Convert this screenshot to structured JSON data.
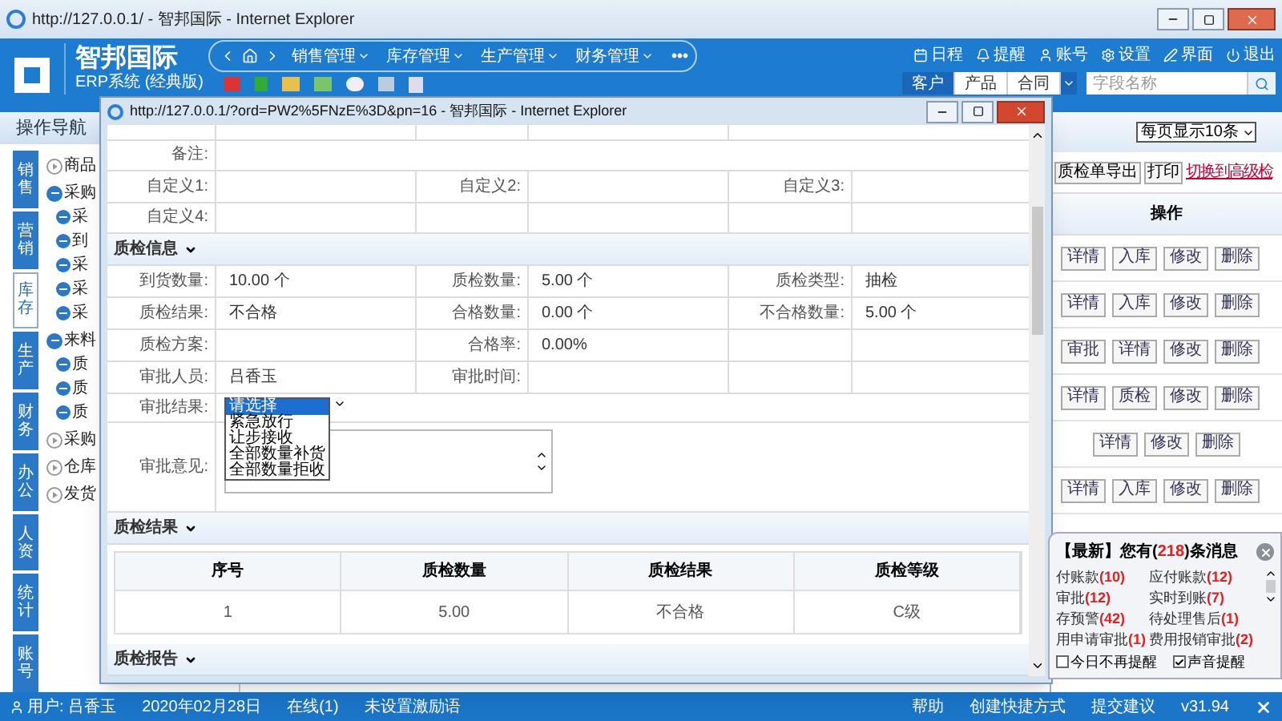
{
  "browser": {
    "title": "http://127.0.0.1/ - 智邦国际 - Internet Explorer"
  },
  "header": {
    "logo_title": "智邦国际",
    "logo_subtitle": "ERP系统 (经典版)",
    "nav_menus": [
      "销售管理",
      "库存管理",
      "生产管理",
      "财务管理"
    ],
    "more": "•••",
    "tools": [
      {
        "kind": "calendar",
        "label": "日程"
      },
      {
        "kind": "bell",
        "label": "提醒"
      },
      {
        "kind": "user",
        "label": "账号"
      },
      {
        "kind": "gear",
        "label": "设置"
      },
      {
        "kind": "brush",
        "label": "界面"
      },
      {
        "kind": "power",
        "label": "退出"
      }
    ],
    "tabs": [
      {
        "label": "客户",
        "selected": true
      },
      {
        "label": "产品",
        "selected": false
      },
      {
        "label": "合同",
        "selected": false
      }
    ],
    "search": {
      "placeholder": "字段名称"
    }
  },
  "sidebar": {
    "title": "操作导航",
    "tabs": [
      {
        "label": "销售",
        "selected": false
      },
      {
        "label": "营销",
        "selected": false
      },
      {
        "label": "库存",
        "selected": true
      },
      {
        "label": "生产",
        "selected": false
      },
      {
        "label": "财务",
        "selected": false
      },
      {
        "label": "办公",
        "selected": false
      },
      {
        "label": "人资",
        "selected": false
      },
      {
        "label": "统计",
        "selected": false
      },
      {
        "label": "账号",
        "selected": false
      }
    ],
    "tree": [
      {
        "label": "商品",
        "expanded": false
      },
      {
        "label": "采购",
        "expanded": true,
        "children": [
          {
            "label": "采",
            "expanded": true
          },
          {
            "label": "到",
            "expanded": true
          },
          {
            "label": "采",
            "expanded": true
          },
          {
            "label": "采",
            "expanded": true
          },
          {
            "label": "采",
            "expanded": true
          }
        ]
      },
      {
        "label": "来料",
        "expanded": true,
        "children": [
          {
            "label": "质",
            "expanded": true
          },
          {
            "label": "质",
            "expanded": true
          },
          {
            "label": "质",
            "expanded": true
          }
        ]
      },
      {
        "label": "采购",
        "expanded": false
      },
      {
        "label": "仓库",
        "expanded": false
      },
      {
        "label": "发货",
        "expanded": false
      }
    ]
  },
  "modal": {
    "title": "http://127.0.0.1/?ord=PW2%5FNzE%3D&pn=16 - 智邦国际 - Internet Explorer",
    "top_rows": [
      {
        "kind": "wide",
        "fields": [
          {
            "label": "备注:"
          }
        ]
      },
      {
        "kind": "fields",
        "fields": [
          {
            "label": "自定义1:"
          },
          {
            "label": "自定义2:"
          },
          {
            "label": "自定义3:"
          }
        ]
      },
      {
        "kind": "fields",
        "fields": [
          {
            "label": "自定义4:"
          }
        ]
      }
    ],
    "sections": [
      {
        "title": "质检信息",
        "rows": [
          {
            "kind": "fields",
            "fields": [
              {
                "label": "到货数量:",
                "value": "10.00 个"
              },
              {
                "label": "质检数量:",
                "value": "5.00 个"
              },
              {
                "label": "质检类型:",
                "value": "抽检"
              }
            ]
          },
          {
            "kind": "fields",
            "fields": [
              {
                "label": "质检结果:",
                "value": "不合格"
              },
              {
                "label": "合格数量:",
                "value": "0.00 个"
              },
              {
                "label": "不合格数量:",
                "value": "5.00 个"
              }
            ]
          },
          {
            "kind": "fields",
            "fields": [
              {
                "label": "质检方案:"
              },
              {
                "label": "合格率:",
                "value": "0.00%"
              }
            ]
          },
          {
            "kind": "fields",
            "fields": [
              {
                "label": "审批人员:",
                "value": "吕香玉"
              },
              {
                "label": "审批时间:"
              }
            ]
          },
          {
            "kind": "select",
            "label": "审批结果:",
            "expanded": true,
            "options": [
              {
                "label": "请选择",
                "selected": true
              },
              {
                "label": "紧急放行",
                "selected": false
              },
              {
                "label": "让步接收",
                "selected": false
              },
              {
                "label": "全部数量补货",
                "selected": false
              },
              {
                "label": "全部数量拒收",
                "selected": false
              }
            ]
          },
          {
            "kind": "textarea",
            "label": "审批意见:"
          }
        ]
      },
      {
        "title": "质检结果",
        "table": {
          "columns": [
            "序号",
            "质检数量",
            "质检结果",
            "质检等级"
          ],
          "rows": [
            [
              "1",
              "5.00",
              "不合格",
              "C级"
            ]
          ]
        }
      },
      {
        "title": "质检报告"
      }
    ]
  },
  "right_panel": {
    "page_size": "每页显示10条",
    "buttons": [
      "质检单导出",
      "打印"
    ],
    "link": "切换到高级检",
    "column": "操作",
    "rows": [
      [
        "详情",
        "入库",
        "修改",
        "删除"
      ],
      [
        "详情",
        "入库",
        "修改",
        "删除"
      ],
      [
        "审批",
        "详情",
        "修改",
        "删除"
      ],
      [
        "详情",
        "质检",
        "修改",
        "删除"
      ],
      [
        "详情",
        "修改",
        "删除"
      ],
      [
        "详情",
        "入库",
        "修改",
        "删除"
      ]
    ]
  },
  "notification": {
    "title_prefix": "【最新】您有(",
    "count": "218",
    "title_suffix": ")条消息",
    "items": [
      {
        "label": "付账款",
        "count": "(10)"
      },
      {
        "label": "应付账款",
        "count": "(12)"
      },
      {
        "label": "审批",
        "count": "(12)"
      },
      {
        "label": "实时到账",
        "count": "(7)"
      },
      {
        "label": "存预警",
        "count": "(42)"
      },
      {
        "label": "待处理售后",
        "count": "(1)"
      },
      {
        "label": "用申请审批",
        "count": "(1)"
      },
      {
        "label": "费用报销审批",
        "count": "(2)"
      }
    ],
    "options": [
      {
        "label": "今日不再提醒",
        "checked": false
      },
      {
        "label": "声音提醒",
        "checked": true
      }
    ]
  },
  "status_bar": {
    "user": "用户: 吕香玉",
    "date": "2020年02月28日",
    "online": "在线(1)",
    "motto": "未设置激励语",
    "links": [
      "帮助",
      "创建快捷方式",
      "提交建议"
    ],
    "version": "v31.94"
  }
}
